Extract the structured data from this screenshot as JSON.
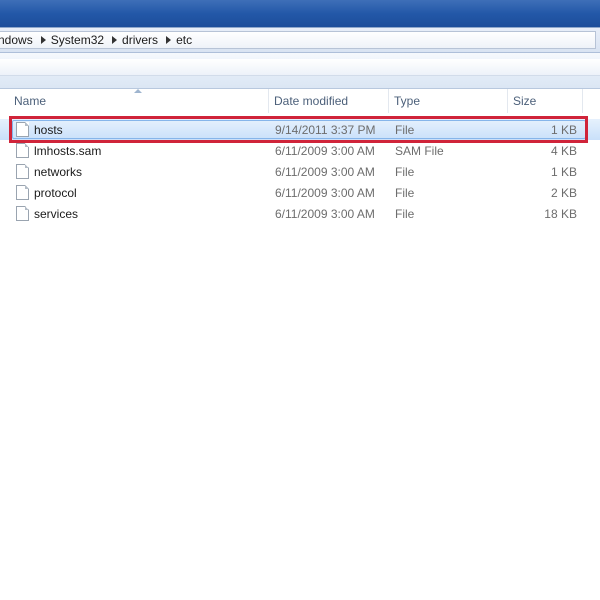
{
  "breadcrumb": {
    "items": [
      "ndows",
      "System32",
      "drivers",
      "etc"
    ]
  },
  "columns": {
    "name": "Name",
    "date_modified": "Date modified",
    "type": "Type",
    "size": "Size"
  },
  "files": [
    {
      "name": "hosts",
      "date": "9/14/2011 3:37 PM",
      "type": "File",
      "size": "1 KB",
      "selected": true
    },
    {
      "name": "lmhosts.sam",
      "date": "6/11/2009 3:00 AM",
      "type": "SAM File",
      "size": "4 KB"
    },
    {
      "name": "networks",
      "date": "6/11/2009 3:00 AM",
      "type": "File",
      "size": "1 KB"
    },
    {
      "name": "protocol",
      "date": "6/11/2009 3:00 AM",
      "type": "File",
      "size": "2 KB"
    },
    {
      "name": "services",
      "date": "6/11/2009 3:00 AM",
      "type": "File",
      "size": "18 KB"
    }
  ],
  "icons": {
    "file": "file-icon",
    "breadcrumb_separator": "chevron-right-icon",
    "sort": "sort-ascending-icon"
  },
  "colors": {
    "title_bar": "#2358a8",
    "selection": "#c9e0fa",
    "highlight_border": "#d0243a"
  }
}
